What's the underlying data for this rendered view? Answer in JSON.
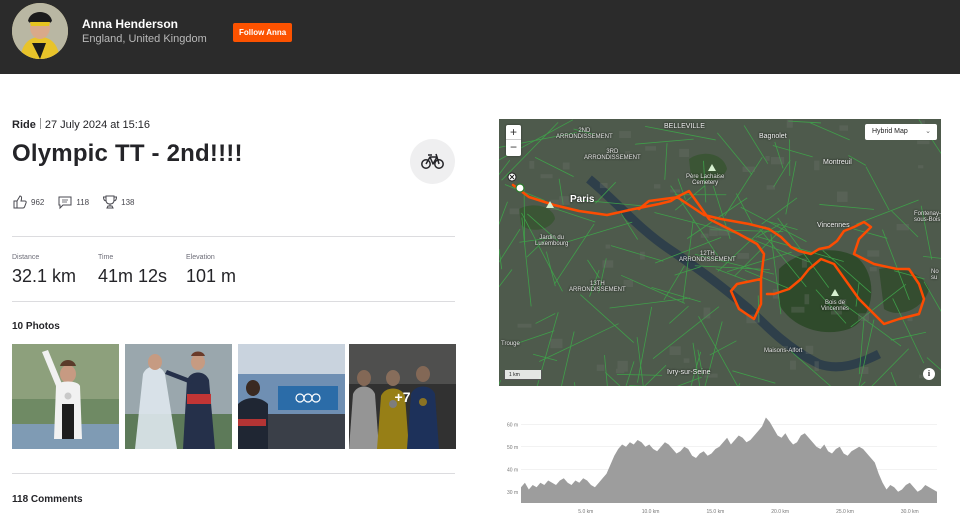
{
  "header": {
    "athlete_name": "Anna Henderson",
    "location": "England, United Kingdom",
    "follow_label": "Follow Anna"
  },
  "activity": {
    "type": "Ride",
    "date": "27 July 2024 at 15:16",
    "title": "Olympic TT - 2nd!!!!",
    "sport_icon": "bicycle-icon",
    "kudos": "962",
    "comments_count": "118",
    "achievements": "138"
  },
  "stats": [
    {
      "label": "Distance",
      "value": "32.1 km"
    },
    {
      "label": "Time",
      "value": "41m 12s"
    },
    {
      "label": "Elevation",
      "value": "101 m"
    }
  ],
  "photos": {
    "heading": "10 Photos",
    "more_label": "+7"
  },
  "comments": {
    "heading": "118 Comments"
  },
  "map": {
    "zoom_in": "+",
    "zoom_out": "−",
    "map_type": "Hybrid Map",
    "scale": "1 km",
    "info": "i",
    "route_color": "#fc4c02",
    "labels": {
      "belleville": "BELLEVILLE",
      "bagnolet": "Bagnolet",
      "montreuil": "Montreuil",
      "fontenay": "Fontenay-\nsous-Bois",
      "arr2": "2ND\nARRONDISSEMENT",
      "arr3": "3RD\nARRONDISSEMENT",
      "pere_lachaise": "Père Lachaise\nCemetery",
      "paris": "Paris",
      "jardin": "Jardin du\nLuxembourg",
      "vincennes": "Vincennes",
      "arr12": "12TH\nARRONDISSEMENT",
      "arr13": "13TH\nARRONDISSEMENT",
      "bois": "Bois de\nVincennes",
      "nogent": "No\nsu",
      "maisons": "Maisons-Alfort",
      "ivry": "Ivry-sur-Seine",
      "vitry": "Vitry",
      "rouge": "Trouge"
    }
  },
  "elevation": {
    "y_ticks": [
      "60 m",
      "50 m",
      "40 m",
      "30 m"
    ],
    "x_ticks": [
      "5.0 km",
      "10.0 km",
      "15.0 km",
      "20.0 km",
      "25.0 km",
      "30.0 km"
    ],
    "profile_m": [
      32,
      34,
      31,
      33,
      32,
      34,
      33,
      35,
      34,
      33,
      35,
      36,
      34,
      33,
      35,
      34,
      36,
      35,
      33,
      32,
      34,
      36,
      38,
      42,
      46,
      49,
      51,
      50,
      52,
      51,
      53,
      52,
      50,
      51,
      49,
      48,
      50,
      52,
      51,
      49,
      47,
      48,
      50,
      49,
      46,
      45,
      47,
      48,
      46,
      47,
      49,
      50,
      52,
      54,
      51,
      53,
      55,
      54,
      52,
      53,
      55,
      57,
      59,
      63,
      61,
      58,
      55,
      54,
      56,
      53,
      51,
      52,
      55,
      56,
      54,
      52,
      50,
      49,
      51,
      48,
      47,
      49,
      50,
      47,
      46,
      48,
      49,
      50,
      49,
      47,
      45,
      43,
      38,
      34,
      31,
      33,
      32,
      30,
      31,
      33,
      34,
      32,
      30,
      31,
      33,
      32,
      31,
      30
    ]
  }
}
